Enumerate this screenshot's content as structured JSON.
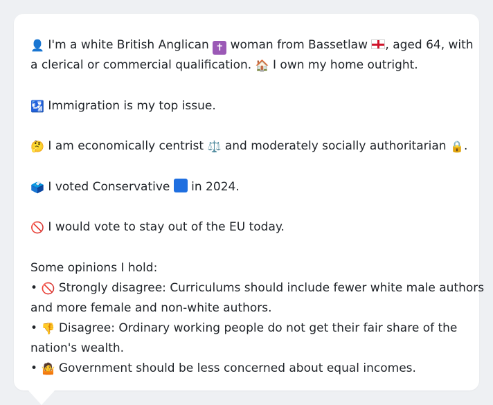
{
  "colors": {
    "background": "#eef0f3",
    "bubble": "#ffffff",
    "text": "#1f2328",
    "immigration_badge": "#2f8ee0",
    "religion_badge": "#9b59b6",
    "conservative_square": "#1f6fe0"
  },
  "profile": {
    "line1_a": "I'm a white British Anglican",
    "line1_b": "woman from Bassetlaw",
    "line1_c": ", aged 64, with",
    "line2_a": "a clerical or commercial qualification.",
    "line2_b": "I own my home outright.",
    "top_issue": "Immigration is my top issue.",
    "ideology_a": "I am economically centrist",
    "ideology_b": "and moderately socially authoritarian",
    "ideology_end": ".",
    "vote_a": "I voted Conservative",
    "vote_b": "in 2024.",
    "eu": "I would vote to stay out of the EU today."
  },
  "opinions": {
    "heading": "Some opinions I hold:",
    "bullet": "•",
    "item1_line1": "Strongly disagree: Curriculums should include fewer white male authors",
    "item1_line2": "and more female and non-white authors.",
    "item2_line1": "Disagree: Ordinary working people do not get their fair share of the",
    "item2_line2": "nation's wealth.",
    "item3": "Government should be less concerned about equal incomes."
  },
  "icons": {
    "person": "👤",
    "cross": "✝",
    "flag": "england-flag-icon",
    "house": "🏠",
    "immigration": "🛂",
    "thinking": "🤔",
    "scales": "⚖️",
    "lock": "🔒",
    "ballot": "🗳️",
    "blue_square": "conservative-blue-square-icon",
    "prohibited": "🚫",
    "thumbs_down": "👎",
    "shrug": "🤷"
  }
}
